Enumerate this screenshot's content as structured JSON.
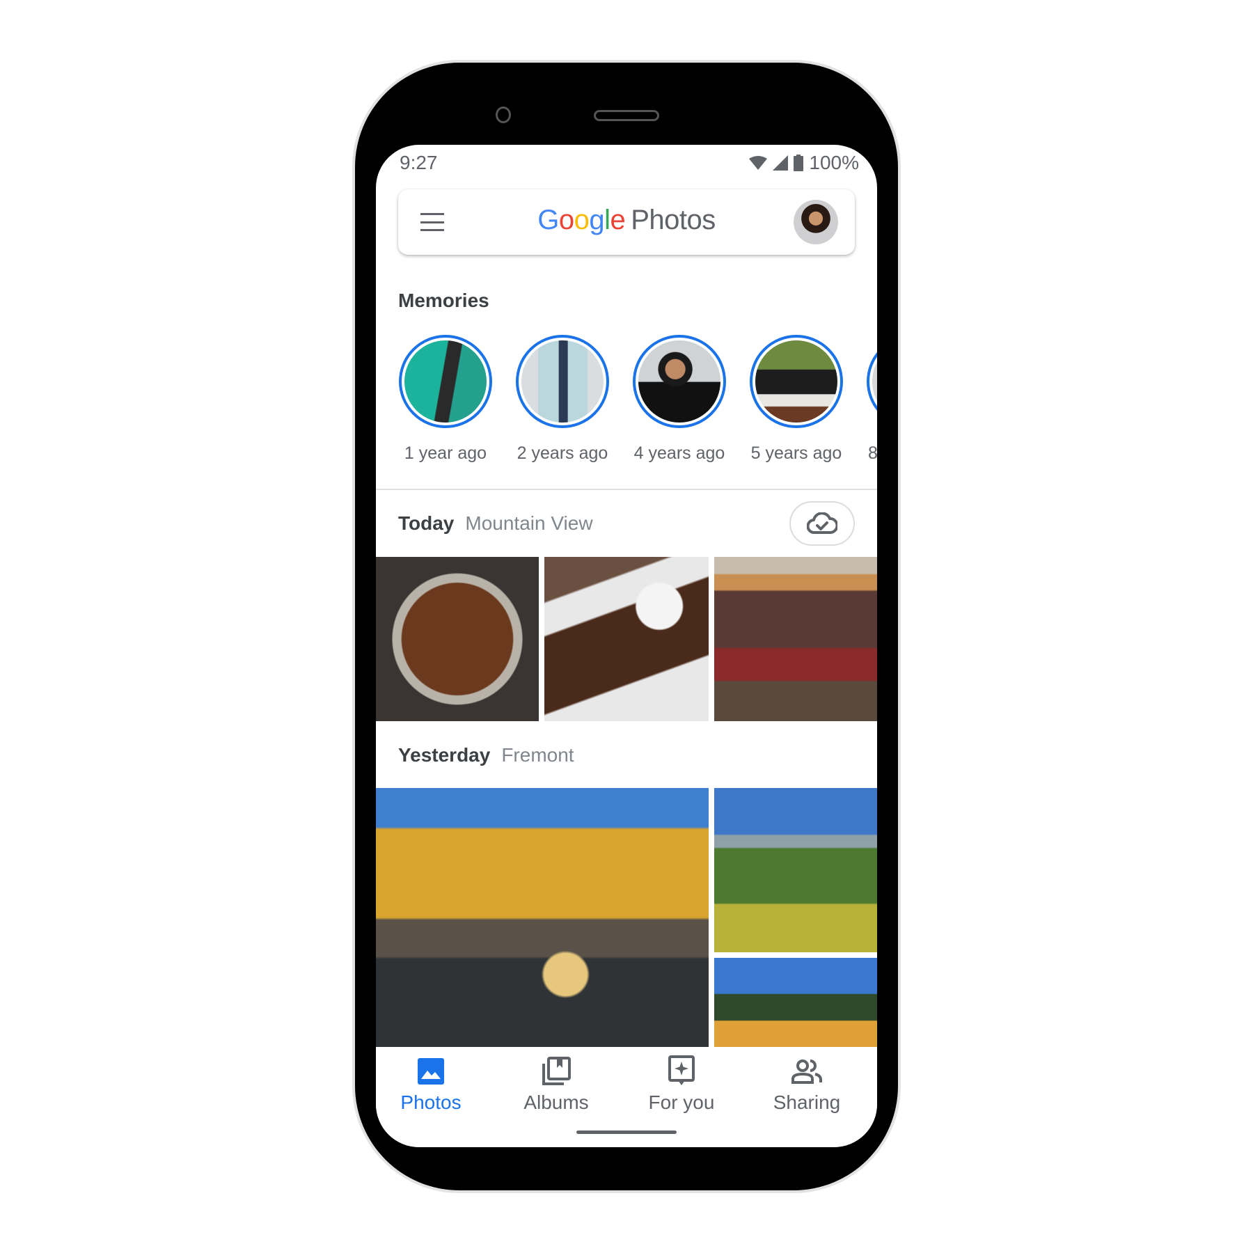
{
  "status_bar": {
    "time": "9:27",
    "battery": "100%",
    "icons": [
      "wifi-icon",
      "cellular-signal-icon",
      "battery-icon"
    ]
  },
  "header": {
    "menu_icon": "hamburger-menu-icon",
    "logo_letters": [
      "G",
      "o",
      "o",
      "g",
      "l",
      "e"
    ],
    "logo_product": "Photos",
    "avatar": "account-avatar"
  },
  "memories": {
    "title": "Memories",
    "items": [
      {
        "label": "1 year ago"
      },
      {
        "label": "2 years ago"
      },
      {
        "label": "4 years ago"
      },
      {
        "label": "5 years ago"
      },
      {
        "label": "8"
      }
    ]
  },
  "sections": [
    {
      "date": "Today",
      "place": "Mountain View",
      "action_icon": "cloud-backup-done-icon"
    },
    {
      "date": "Yesterday",
      "place": "Fremont"
    }
  ],
  "bottom_nav": {
    "items": [
      {
        "label": "Photos",
        "icon": "photo-icon",
        "active": true
      },
      {
        "label": "Albums",
        "icon": "albums-icon",
        "active": false
      },
      {
        "label": "For you",
        "icon": "for-you-icon",
        "active": false
      },
      {
        "label": "Sharing",
        "icon": "sharing-icon",
        "active": false
      }
    ]
  },
  "colors": {
    "accent": "#1a73e8",
    "text_primary": "#3c4043",
    "text_secondary": "#5f6368"
  }
}
